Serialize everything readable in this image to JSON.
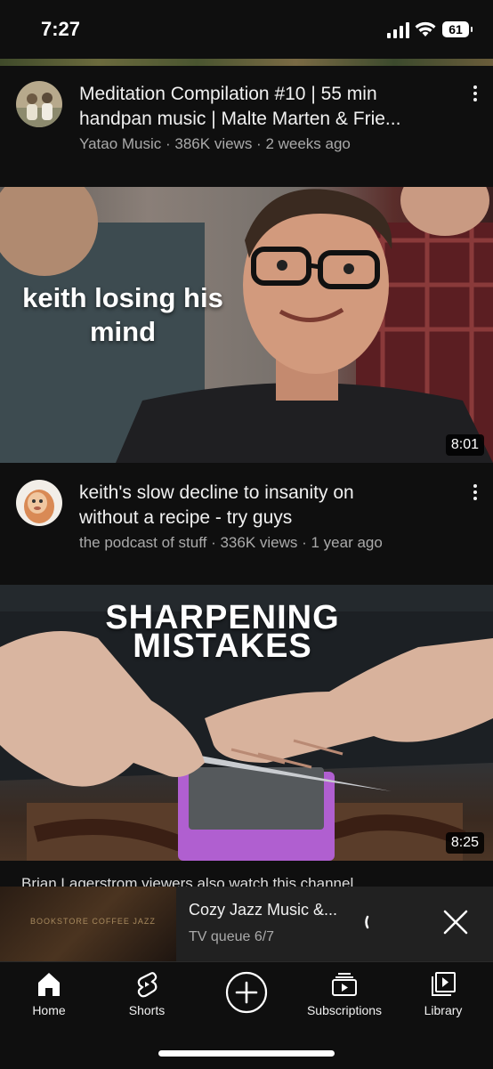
{
  "status_bar": {
    "time": "7:27",
    "battery": "61"
  },
  "feed": [
    {
      "title": "Meditation Compilation #10 | 55 min handpan music | Malte Marten & Frie...",
      "title_line1": "Meditation Compilation #10 | 55 min",
      "title_line2": "handpan music | Malte Marten & Frie...",
      "channel": "Yatao Music",
      "views": "386K views",
      "age": "2 weeks ago"
    },
    {
      "thumbnail_text": "keith losing his mind",
      "duration": "8:01",
      "title_line1": "keith's slow decline to insanity on",
      "title_line2": "without a recipe - try guys",
      "channel": "the podcast of stuff",
      "views": "336K views",
      "age": "1 year ago"
    },
    {
      "thumbnail_text_line1": "SHARPENING",
      "thumbnail_text_line2": "MISTAKES",
      "duration": "8:25"
    }
  ],
  "shelf_label": "Brian Lagerstrom  viewers also watch this channel",
  "mini_player": {
    "title": "Cozy Jazz Music &...",
    "subtitle": "TV queue 6/7",
    "thumbnail_tag": "BOOKSTORE COFFEE JAZZ"
  },
  "bottom_nav": [
    {
      "label": "Home",
      "icon": "home-icon"
    },
    {
      "label": "Shorts",
      "icon": "shorts-icon"
    },
    {
      "label": "",
      "icon": "create-plus-icon"
    },
    {
      "label": "Subscriptions",
      "icon": "subscriptions-icon"
    },
    {
      "label": "Library",
      "icon": "library-icon"
    }
  ],
  "colors": {
    "background": "#0f0f0f",
    "secondary_text": "#aaaaaa",
    "mini_player_bg": "#212121"
  }
}
